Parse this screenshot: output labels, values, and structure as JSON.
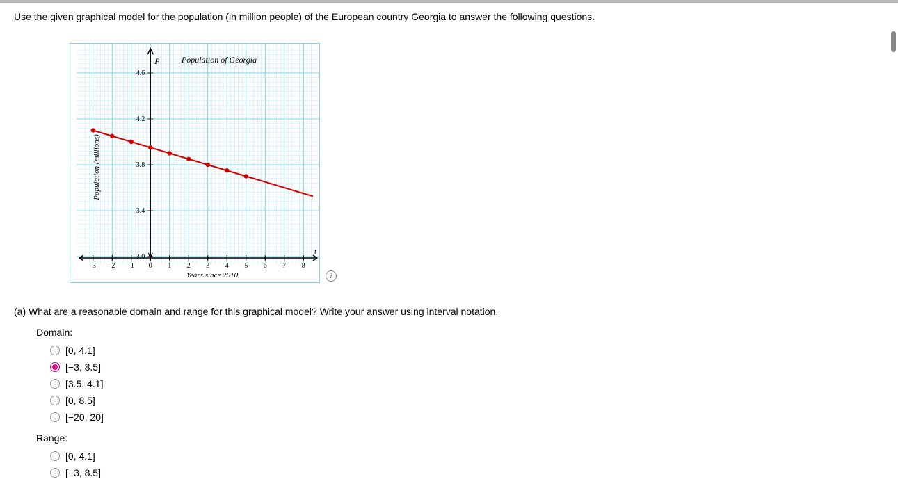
{
  "question": {
    "prompt": "Use the given graphical model for the population (in million people) of the European country Georgia to answer the following questions.",
    "part_a": "(a)   What are a reasonable domain and range for this graphical model? Write your answer using interval notation.",
    "domain_label": "Domain:",
    "range_label": "Range:"
  },
  "options": {
    "domain": [
      {
        "label": "[0, 4.1]",
        "selected": false
      },
      {
        "label": "[−3, 8.5]",
        "selected": true
      },
      {
        "label": "[3.5, 4.1]",
        "selected": false
      },
      {
        "label": "[0, 8.5]",
        "selected": false
      },
      {
        "label": "[−20, 20]",
        "selected": false
      }
    ],
    "range": [
      {
        "label": "[0, 4.1]",
        "selected": false
      },
      {
        "label": "[−3, 8.5]",
        "selected": false
      }
    ]
  },
  "chart_data": {
    "type": "line",
    "title": "Population of Georgia",
    "xlabel": "Years since 2010",
    "ylabel": "Population (millions)",
    "y_axis_symbol": "P",
    "x_ticks": [
      -3,
      -2,
      -1,
      0,
      1,
      2,
      3,
      4,
      5,
      6,
      7,
      8
    ],
    "y_ticks": [
      3.0,
      3.4,
      3.8,
      4.2,
      4.6
    ],
    "xlim": [
      -3.5,
      8.5
    ],
    "ylim": [
      3.0,
      4.8
    ],
    "series": [
      {
        "name": "Population",
        "color": "#d40000",
        "points": [
          {
            "x": -3,
            "y": 4.1
          },
          {
            "x": -2,
            "y": 4.05
          },
          {
            "x": -1,
            "y": 4.0
          },
          {
            "x": 0,
            "y": 3.95
          },
          {
            "x": 1,
            "y": 3.9
          },
          {
            "x": 2,
            "y": 3.85
          },
          {
            "x": 3,
            "y": 3.8
          },
          {
            "x": 4,
            "y": 3.75
          },
          {
            "x": 5,
            "y": 3.7
          }
        ],
        "extrapolate_to_x": 8.5
      }
    ]
  }
}
